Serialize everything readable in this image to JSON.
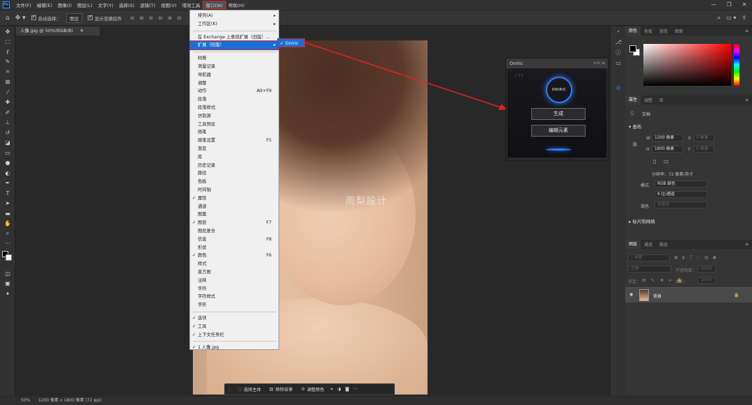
{
  "menubar": {
    "logo": "Ps",
    "items": [
      "文件(F)",
      "编辑(E)",
      "图像(I)",
      "图层(L)",
      "文字(Y)",
      "选择(S)",
      "滤镜(T)",
      "视图(V)",
      "增效工具",
      "窗口(W)",
      "帮助(H)"
    ],
    "active_index": 9
  },
  "window_controls": [
    "—",
    "❐",
    "✕"
  ],
  "options": {
    "auto_select_label": "自动选择：",
    "auto_select_value": "图层",
    "show_transform_label": "显示变换控件"
  },
  "document_tab": {
    "title": "人像.jpg @ 50%(RGB/8)",
    "close": "✕"
  },
  "canvas": {
    "watermark": "雨梨設计"
  },
  "window_menu": {
    "items": [
      {
        "label": "排列(A)",
        "arrow": "▸"
      },
      {
        "label": "工作区(K)",
        "arrow": "▸"
      },
      {
        "sep": true
      },
      {
        "label": "在 Exchange 上查找扩展（旧版）..."
      },
      {
        "label": "扩展（旧版）",
        "arrow": "▸",
        "highlight": true
      },
      {
        "sep": true
      },
      {
        "label": "材质"
      },
      {
        "label": "测量记录"
      },
      {
        "label": "导航器"
      },
      {
        "label": "调整"
      },
      {
        "label": "动作",
        "shortcut": "Alt+F9"
      },
      {
        "label": "段落"
      },
      {
        "label": "段落样式"
      },
      {
        "label": "仿制源"
      },
      {
        "label": "工具预设"
      },
      {
        "label": "画笔"
      },
      {
        "label": "画笔设置",
        "shortcut": "F5"
      },
      {
        "label": "渐变"
      },
      {
        "label": "库"
      },
      {
        "label": "历史记录"
      },
      {
        "label": "路径"
      },
      {
        "label": "色板"
      },
      {
        "label": "时间轴"
      },
      {
        "label": "属性",
        "check": true
      },
      {
        "label": "通道"
      },
      {
        "label": "图案"
      },
      {
        "label": "图层",
        "shortcut": "F7",
        "check": true
      },
      {
        "label": "图层复合"
      },
      {
        "label": "信息",
        "shortcut": "F8"
      },
      {
        "label": "形状"
      },
      {
        "label": "颜色",
        "shortcut": "F6",
        "check": true
      },
      {
        "label": "样式"
      },
      {
        "label": "直方图"
      },
      {
        "label": "注释"
      },
      {
        "label": "字符"
      },
      {
        "label": "字符样式"
      },
      {
        "label": "字形"
      },
      {
        "sep": true
      },
      {
        "label": "选项",
        "check": true
      },
      {
        "label": "工具",
        "check": true
      },
      {
        "label": "上下文任务栏",
        "check": true
      },
      {
        "sep": true
      },
      {
        "label": "1 人像.jpg",
        "check": true
      }
    ]
  },
  "submenu": {
    "label": "Oniric",
    "check": "✓"
  },
  "oniric_panel": {
    "title": "Oniric",
    "header_controls": ">> ≡",
    "version": "1.3.0",
    "logo_text": "ONIRIC",
    "generate_button": "生成",
    "edit_button": "编辑元素"
  },
  "color_panel": {
    "tabs": [
      "颜色",
      "色板",
      "渐变",
      "图案"
    ]
  },
  "properties_panel": {
    "tabs": [
      "属性",
      "调整",
      "库"
    ],
    "doc_label": "文档",
    "canvas_header": "画布",
    "w_label": "W",
    "w_value": "1200 像素",
    "h_label": "H",
    "h_value": "1800 像素",
    "x_label": "X",
    "x_value": "0 像素",
    "y_label": "Y",
    "y_value": "0 像素",
    "resolution": "分辨率：72 像素/英寸",
    "mode_label": "模式",
    "mode_value": "RGB 颜色",
    "depth_value": "8 位/通道",
    "fill_label": "填色",
    "fill_value": "背景色",
    "rulers_header": "标尺和网格"
  },
  "layers_panel": {
    "tabs": [
      "图层",
      "通道",
      "路径"
    ],
    "search_placeholder": "类型",
    "blend_mode": "正常",
    "opacity_label": "不透明度：",
    "opacity_value": "100%",
    "lock_label": "锁定：",
    "fill_label": "填充：",
    "fill_value": "100%",
    "layer_name": "背景"
  },
  "context_bar": {
    "select_subject": "选择主体",
    "remove_bg": "移除背景",
    "adjust_color": "调整颜色",
    "more": "···"
  },
  "status": {
    "zoom": "50%",
    "size": "1200 像素 x 1800 像素 (72 ppi)"
  },
  "accent_color": "#1a6fd6",
  "arrow_color": "#e02424"
}
